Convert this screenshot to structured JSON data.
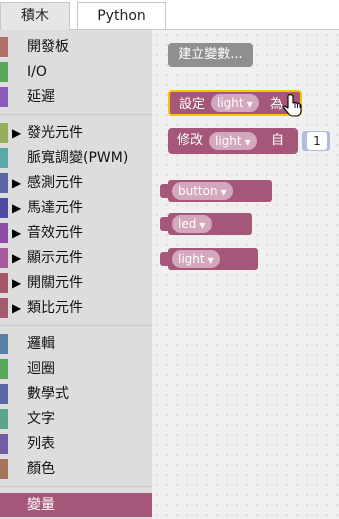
{
  "tabs": {
    "blocks": "積木",
    "python": "Python"
  },
  "categories": [
    {
      "label": "開發板",
      "color": "#b3706b",
      "arrow": ""
    },
    {
      "label": "I/O",
      "color": "#5ba55b",
      "arrow": ""
    },
    {
      "label": "延遲",
      "color": "#8a5bb8",
      "arrow": ""
    },
    {
      "label": "發光元件",
      "color": "#97ae5a",
      "arrow": "▶"
    },
    {
      "label": "脈寬調變(PWM)",
      "color": "#5aa8a8",
      "arrow": ""
    },
    {
      "label": "感測元件",
      "color": "#5b67a5",
      "arrow": "▶"
    },
    {
      "label": "馬達元件",
      "color": "#4b4ba5",
      "arrow": "▶"
    },
    {
      "label": "音效元件",
      "color": "#8c4ba5",
      "arrow": "▶"
    },
    {
      "label": "顯示元件",
      "color": "#a55b9c",
      "arrow": "▶"
    },
    {
      "label": "開關元件",
      "color": "#a5576a",
      "arrow": "▶"
    },
    {
      "label": "類比元件",
      "color": "#a55b6e",
      "arrow": "▶"
    },
    {
      "label": "邏輯",
      "color": "#5b80a5",
      "arrow": ""
    },
    {
      "label": "迴圈",
      "color": "#5ba55b",
      "arrow": ""
    },
    {
      "label": "數學式",
      "color": "#5b67a5",
      "arrow": ""
    },
    {
      "label": "文字",
      "color": "#5ba58c",
      "arrow": ""
    },
    {
      "label": "列表",
      "color": "#745ba5",
      "arrow": ""
    },
    {
      "label": "顏色",
      "color": "#a5745b",
      "arrow": ""
    },
    {
      "label": "變量",
      "color": "#a5577a",
      "arrow": ""
    }
  ],
  "flyout": {
    "create_variable": "建立變數...",
    "set_block": {
      "prefix": "設定",
      "var": "light",
      "suffix": "為"
    },
    "change_block": {
      "prefix": "修改",
      "var": "light",
      "suffix": "自",
      "amount": "1"
    },
    "variables": [
      "button",
      "led",
      "light"
    ]
  },
  "colors": {
    "variable_category": "#a5577a",
    "highlight": "#f5c400"
  }
}
